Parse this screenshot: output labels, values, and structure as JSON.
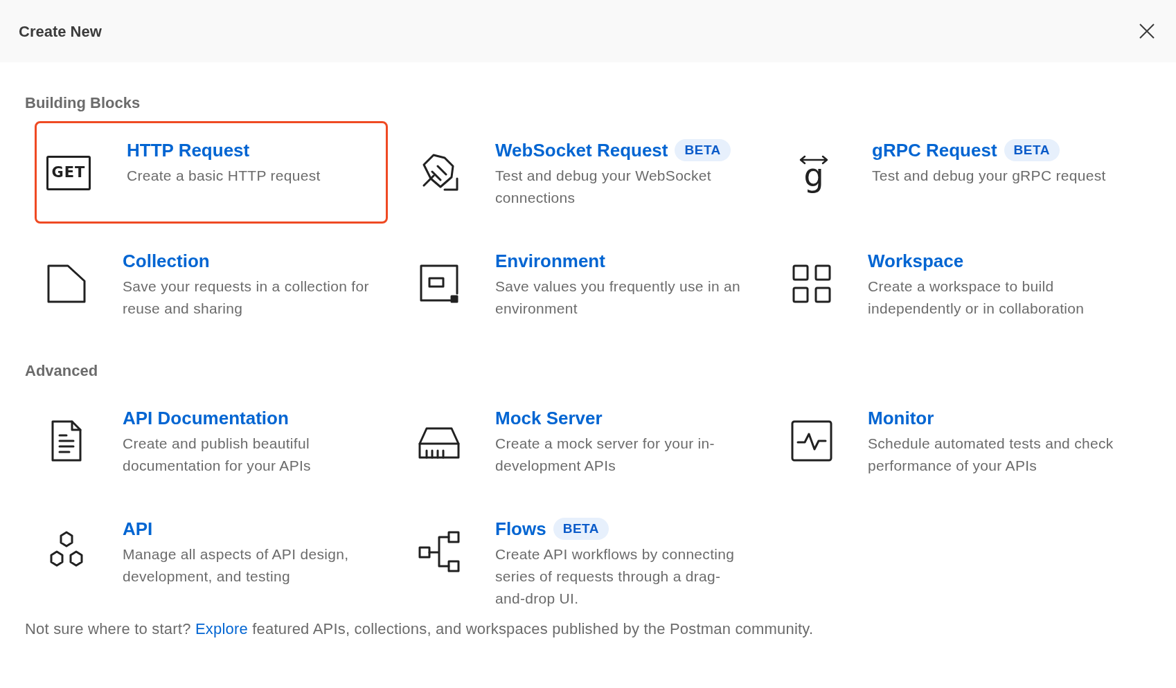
{
  "window": {
    "title": "Create New"
  },
  "sections": [
    {
      "title": "Building Blocks",
      "items": [
        {
          "title": "HTTP Request",
          "description": "Create a basic HTTP request",
          "selected": true,
          "icon_label": "GET"
        },
        {
          "title": "WebSocket Request",
          "badge": "BETA",
          "description": "Test and debug your WebSocket connections",
          "selected": false
        },
        {
          "title": "gRPC Request",
          "badge": "BETA",
          "description": "Test and debug your gRPC request",
          "selected": false,
          "icon_label": "g"
        },
        {
          "title": "Collection",
          "description": "Save your requests in a collection for reuse and sharing",
          "selected": false
        },
        {
          "title": "Environment",
          "description": "Save values you frequently use in an environment",
          "selected": false
        },
        {
          "title": "Workspace",
          "description": "Create a workspace to build independently or in collaboration",
          "selected": false
        }
      ]
    },
    {
      "title": "Advanced",
      "items": [
        {
          "title": "API Documentation",
          "description": "Create and publish beautiful documentation for your APIs",
          "selected": false
        },
        {
          "title": "Mock Server",
          "description": "Create a mock server for your in-development APIs",
          "selected": false
        },
        {
          "title": "Monitor",
          "description": "Schedule automated tests and check performance of your APIs",
          "selected": false
        },
        {
          "title": "API",
          "description": "Manage all aspects of API design, development, and testing",
          "selected": false
        },
        {
          "title": "Flows",
          "badge": "BETA",
          "description": "Create API workflows by connecting series of requests through a drag-and-drop UI.",
          "selected": false
        }
      ]
    }
  ],
  "footer": {
    "before": "Not sure where to start? ",
    "link": "Explore",
    "after": " featured APIs, collections, and workspaces published by the Postman community."
  }
}
